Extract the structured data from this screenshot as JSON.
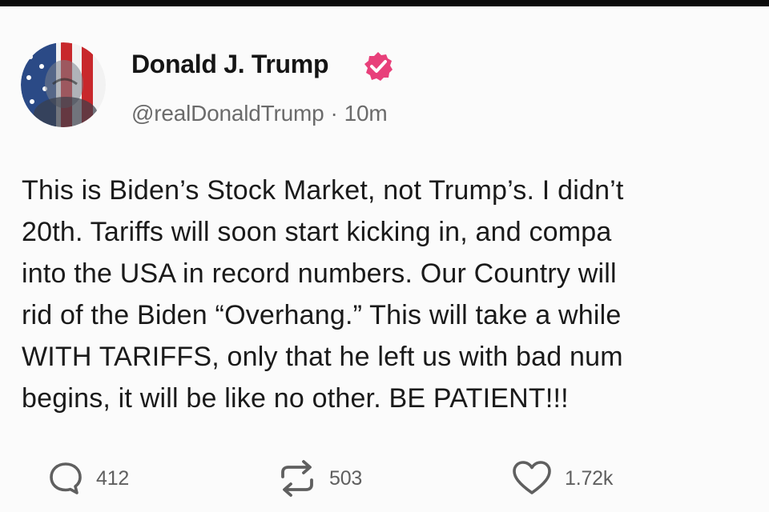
{
  "post": {
    "author": {
      "display_name": "Donald J. Trump",
      "handle": "@realDonaldTrump",
      "time_ago": "10m",
      "verified": true,
      "avatar_icon": "flag-portrait-avatar",
      "verified_icon": "verified-badge-icon",
      "verified_color": "#e8407a"
    },
    "body_lines": [
      "This is Biden’s Stock Market, not Trump’s. I didn’t",
      "20th. Tariffs will soon start kicking in, and compa",
      "into the USA in record numbers. Our Country will",
      "rid of the Biden “Overhang.” This will take a while",
      "WITH TARIFFS, only that he left us with bad num",
      "begins, it will be like no other. BE PATIENT!!!"
    ],
    "actions": {
      "replies": "412",
      "reposts": "503",
      "likes": "1.72k",
      "reply_icon": "reply-icon",
      "repost_icon": "repost-icon",
      "like_icon": "heart-icon"
    }
  },
  "colors": {
    "background": "#fbfbfb",
    "text": "#1a1a1a",
    "muted": "#6b6b6b",
    "top_bar": "#0b0b0b",
    "verified": "#e8407a"
  }
}
